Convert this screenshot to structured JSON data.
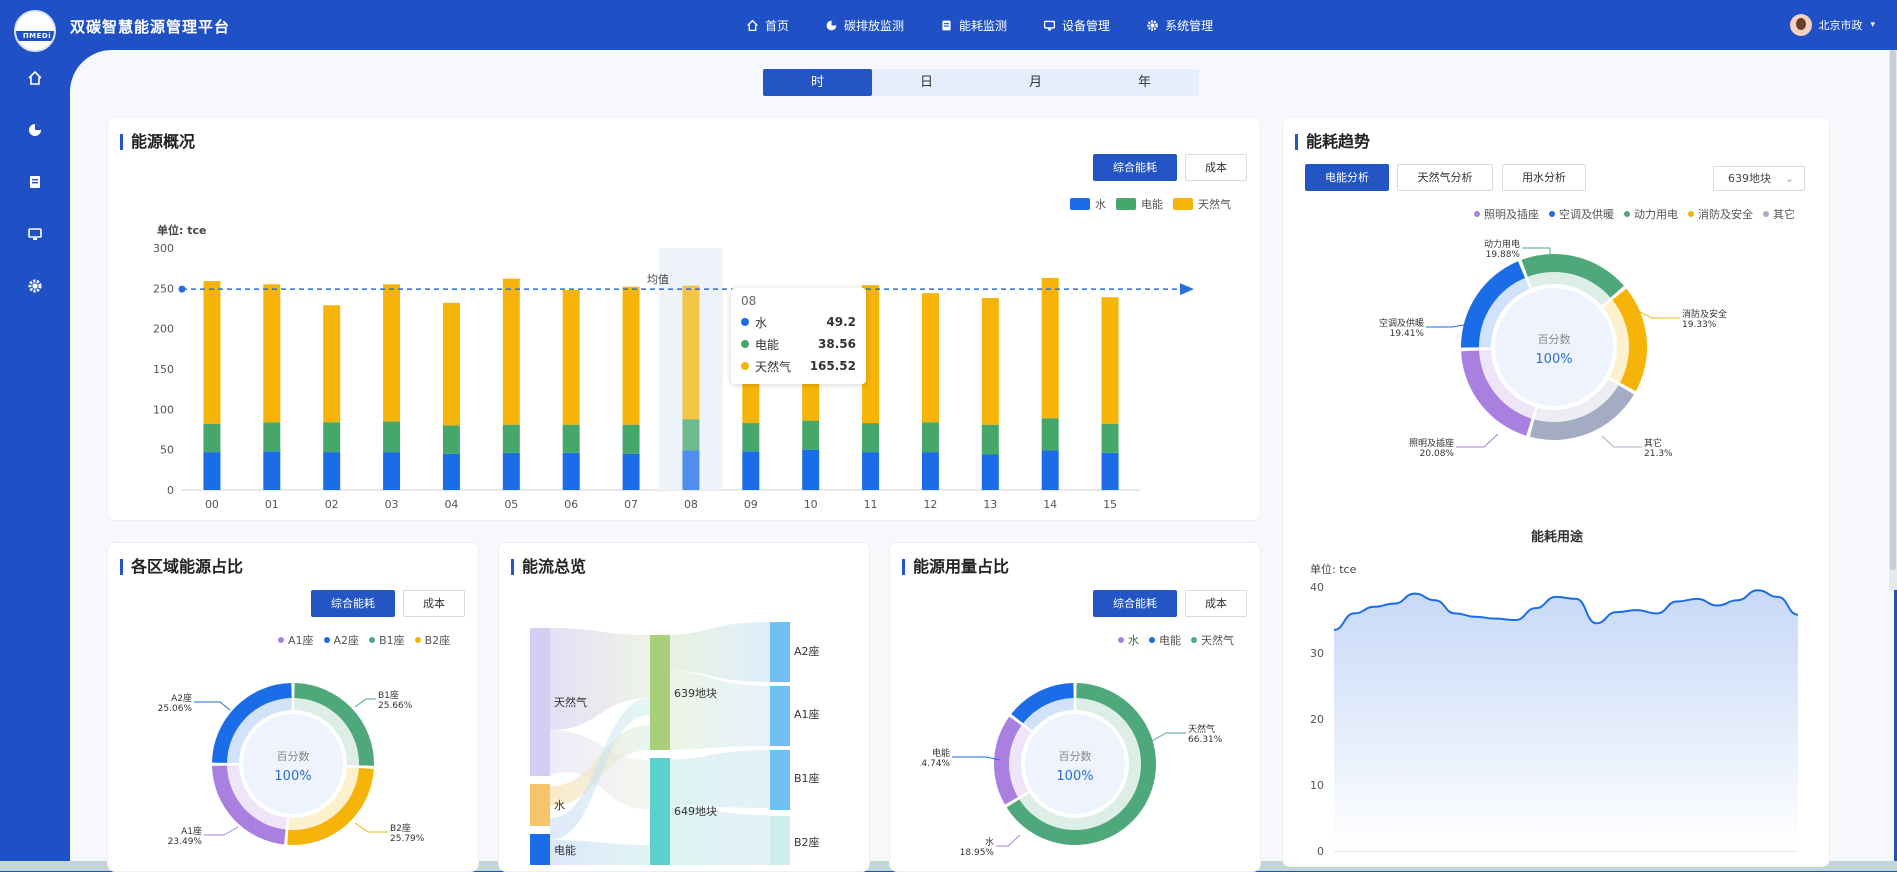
{
  "app": {
    "title": "双碳智慧能源管理平台",
    "logo_text": "ПМЕDi"
  },
  "nav": [
    {
      "label": "首页",
      "icon": "home-icon"
    },
    {
      "label": "碳排放监测",
      "icon": "pie-icon"
    },
    {
      "label": "能耗监测",
      "icon": "clipboard-icon"
    },
    {
      "label": "设备管理",
      "icon": "monitor-icon"
    },
    {
      "label": "系统管理",
      "icon": "gear-icon"
    }
  ],
  "user": {
    "name": "北京市政"
  },
  "sidebar": [
    "home-icon",
    "pie-icon",
    "clipboard-icon",
    "monitor-icon",
    "gear-icon"
  ],
  "time_tabs": {
    "items": [
      "时",
      "日",
      "月",
      "年"
    ],
    "active": "时"
  },
  "overview": {
    "title": "能源概况",
    "btn_primary": "综合能耗",
    "btn_secondary": "成本",
    "unit": "单位: tce",
    "legend": [
      "水",
      "电能",
      "天然气"
    ],
    "colors": {
      "水": "#1a6de6",
      "电能": "#45a86a",
      "天然气": "#f5b407"
    },
    "avg_label": "均值",
    "tooltip": {
      "x": "08",
      "rows": [
        {
          "name": "水",
          "value": "49.2"
        },
        {
          "name": "电能",
          "value": "38.56"
        },
        {
          "name": "天然气",
          "value": "165.52"
        }
      ]
    }
  },
  "trend": {
    "title": "能耗趋势",
    "buttons": [
      "电能分析",
      "天然气分析",
      "用水分析"
    ],
    "select": "639地块",
    "legend": [
      "照明及插座",
      "空调及供暖",
      "动力用电",
      "消防及安全",
      "其它"
    ],
    "center_label": "百分数",
    "center_value": "100%",
    "usage_title": "能耗用途",
    "usage_unit": "单位: tce",
    "slice_labels": [
      {
        "name": "动力用电",
        "pct": "19.88%"
      },
      {
        "name": "消防及安全",
        "pct": "19.33%"
      },
      {
        "name": "其它",
        "pct": "21.3%"
      },
      {
        "name": "照明及插座",
        "pct": "20.08%"
      },
      {
        "name": "空调及供暖",
        "pct": "19.41%"
      }
    ]
  },
  "area": {
    "title": "各区域能源占比",
    "btn_primary": "综合能耗",
    "btn_secondary": "成本",
    "legend": [
      "A1座",
      "A2座",
      "B1座",
      "B2座"
    ],
    "center_label": "百分数",
    "center_value": "100%",
    "slice_labels": [
      {
        "name": "A2座",
        "pct": "25.06%"
      },
      {
        "name": "B1座",
        "pct": "25.66%"
      },
      {
        "name": "B2座",
        "pct": "25.79%"
      },
      {
        "name": "A1座",
        "pct": "23.49%"
      }
    ]
  },
  "flow": {
    "title": "能流总览",
    "sources": [
      "天然气",
      "水",
      "电能"
    ],
    "mid": [
      "639地块",
      "649地块"
    ],
    "targets": [
      "A2座",
      "A1座",
      "B1座",
      "B2座"
    ]
  },
  "usage": {
    "title": "能源用量占比",
    "btn_primary": "综合能耗",
    "btn_secondary": "成本",
    "legend": [
      "水",
      "电能",
      "天然气"
    ],
    "center_label": "百分数",
    "center_value": "100%",
    "slice_labels": [
      {
        "name": "天然气",
        "pct": "66.31%"
      },
      {
        "name": "电能",
        "pct": "14.74%"
      },
      {
        "name": "水",
        "pct": "18.95%"
      }
    ]
  },
  "chart_data": [
    {
      "type": "bar",
      "categories": [
        "00",
        "01",
        "02",
        "03",
        "04",
        "05",
        "06",
        "07",
        "08",
        "09",
        "10",
        "11",
        "12",
        "13",
        "14",
        "15"
      ],
      "series": [
        {
          "name": "水",
          "values": [
            47,
            48,
            47,
            47,
            45,
            46,
            46,
            45,
            49.2,
            48,
            50,
            47,
            47,
            44,
            49,
            46
          ]
        },
        {
          "name": "电能",
          "values": [
            35,
            36,
            37,
            38,
            35,
            35,
            35,
            36,
            38.56,
            35,
            36,
            36,
            37,
            37,
            40,
            36
          ]
        },
        {
          "name": "天然气",
          "values": [
            177,
            171,
            145,
            170,
            152,
            181,
            167,
            171,
            165.52,
            165,
            160,
            171,
            160,
            157,
            174,
            157
          ]
        }
      ],
      "ylim": [
        0,
        300
      ],
      "yticks": [
        0,
        50,
        100,
        150,
        200,
        250,
        300
      ],
      "mean_line": 249,
      "ylabel": "单位: tce"
    },
    {
      "type": "pie",
      "title": "",
      "labels": [
        "动力用电",
        "消防及安全",
        "其它",
        "照明及插座",
        "空调及供暖"
      ],
      "values": [
        19.88,
        19.33,
        21.3,
        20.08,
        19.41
      ],
      "colors": [
        "#4ea87b",
        "#f5b407",
        "#a3acc2",
        "#a97fe0",
        "#1a6de6"
      ]
    },
    {
      "type": "area",
      "title": "能耗用途",
      "ylim": [
        0,
        40
      ],
      "yticks": [
        0,
        10,
        20,
        30,
        40
      ],
      "values": [
        33.5,
        36,
        37,
        37.5,
        39,
        38,
        36,
        35.5,
        35.2,
        35,
        36.8,
        38.5,
        38.2,
        34.5,
        36.2,
        36.5,
        36,
        37.8,
        38.2,
        37.2,
        38,
        39.5,
        38.5,
        35.8
      ],
      "ylabel": "单位: tce"
    },
    {
      "type": "pie",
      "title": "",
      "labels": [
        "B1座",
        "B2座",
        "A1座",
        "A2座"
      ],
      "values": [
        25.66,
        25.79,
        23.49,
        25.06
      ],
      "colors": [
        "#4ea87b",
        "#f5b407",
        "#a97fe0",
        "#1a6de6"
      ]
    },
    {
      "type": "pie",
      "title": "",
      "labels": [
        "天然气",
        "水",
        "电能"
      ],
      "values": [
        66.31,
        18.95,
        14.74
      ],
      "colors": [
        "#4ea87b",
        "#a97fe0",
        "#1a6de6"
      ]
    }
  ]
}
